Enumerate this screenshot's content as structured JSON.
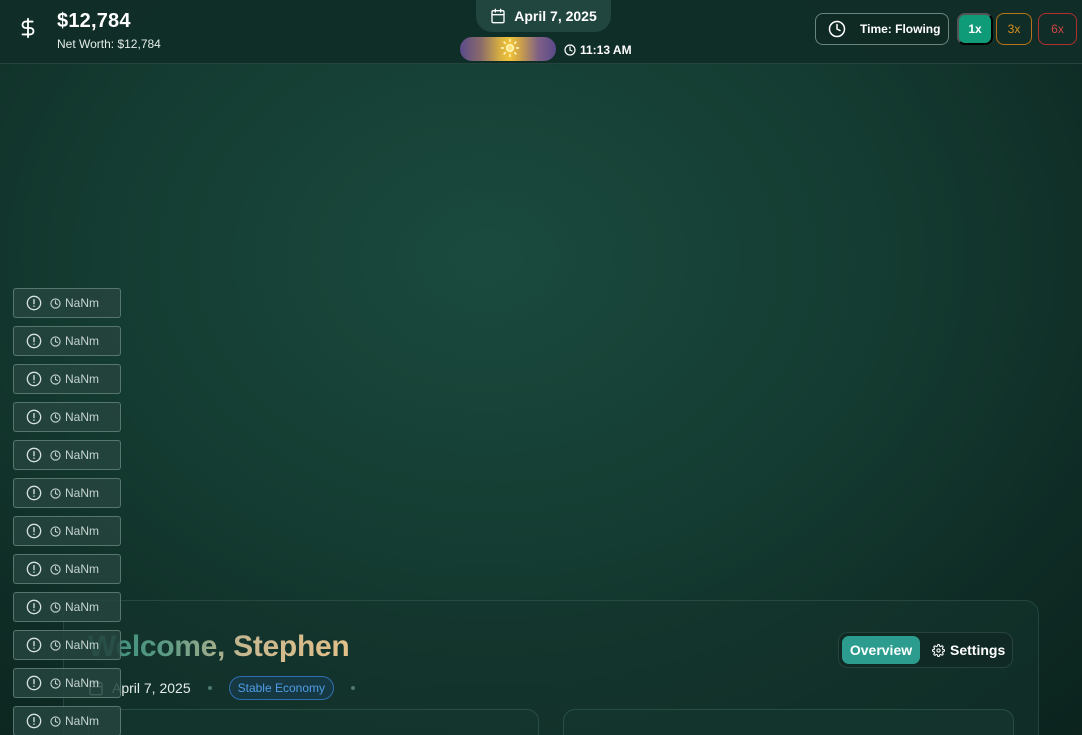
{
  "header": {
    "balance": "$12,784",
    "net_worth": "Net Worth: $12,784",
    "date": "April 7, 2025",
    "time": "11:13 AM",
    "time_flow_label": "Time: Flowing",
    "speeds": [
      "1x",
      "3x",
      "6x"
    ],
    "active_speed": "1x"
  },
  "notifications": [
    {
      "time": "NaNm"
    },
    {
      "time": "NaNm"
    },
    {
      "time": "NaNm"
    },
    {
      "time": "NaNm"
    },
    {
      "time": "NaNm"
    },
    {
      "time": "NaNm"
    },
    {
      "time": "NaNm"
    },
    {
      "time": "NaNm"
    },
    {
      "time": "NaNm"
    },
    {
      "time": "NaNm"
    },
    {
      "time": "NaNm"
    },
    {
      "time": "NaNm"
    }
  ],
  "welcome": {
    "title": "Welcome, Stephen",
    "date": "April 7, 2025",
    "economy_badge": "Stable Economy"
  },
  "tabs": {
    "overview": "Overview",
    "settings": "Settings",
    "active": "overview"
  },
  "colors": {
    "accent": "#0f9a78",
    "speed_3x": "#d98e22",
    "speed_6x": "#d24545",
    "badge_blue": "#4f9ee8",
    "tab_active": "#2c9c8f"
  },
  "icons": {
    "balance": "dollar-icon",
    "date": "calendar-icon",
    "daylight": "sun-icon",
    "time": "clock-icon",
    "notification": "alert-icon"
  }
}
